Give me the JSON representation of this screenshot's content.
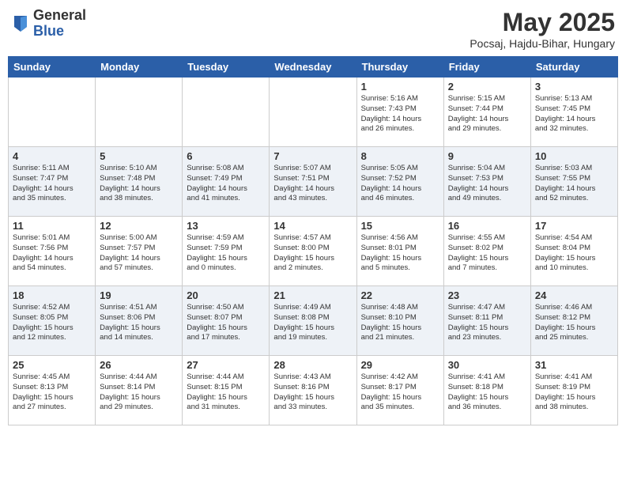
{
  "header": {
    "logo_general": "General",
    "logo_blue": "Blue",
    "title": "May 2025",
    "location": "Pocsaj, Hajdu-Bihar, Hungary"
  },
  "days_of_week": [
    "Sunday",
    "Monday",
    "Tuesday",
    "Wednesday",
    "Thursday",
    "Friday",
    "Saturday"
  ],
  "weeks": [
    [
      {
        "day": "",
        "info": ""
      },
      {
        "day": "",
        "info": ""
      },
      {
        "day": "",
        "info": ""
      },
      {
        "day": "",
        "info": ""
      },
      {
        "day": "1",
        "info": "Sunrise: 5:16 AM\nSunset: 7:43 PM\nDaylight: 14 hours\nand 26 minutes."
      },
      {
        "day": "2",
        "info": "Sunrise: 5:15 AM\nSunset: 7:44 PM\nDaylight: 14 hours\nand 29 minutes."
      },
      {
        "day": "3",
        "info": "Sunrise: 5:13 AM\nSunset: 7:45 PM\nDaylight: 14 hours\nand 32 minutes."
      }
    ],
    [
      {
        "day": "4",
        "info": "Sunrise: 5:11 AM\nSunset: 7:47 PM\nDaylight: 14 hours\nand 35 minutes."
      },
      {
        "day": "5",
        "info": "Sunrise: 5:10 AM\nSunset: 7:48 PM\nDaylight: 14 hours\nand 38 minutes."
      },
      {
        "day": "6",
        "info": "Sunrise: 5:08 AM\nSunset: 7:49 PM\nDaylight: 14 hours\nand 41 minutes."
      },
      {
        "day": "7",
        "info": "Sunrise: 5:07 AM\nSunset: 7:51 PM\nDaylight: 14 hours\nand 43 minutes."
      },
      {
        "day": "8",
        "info": "Sunrise: 5:05 AM\nSunset: 7:52 PM\nDaylight: 14 hours\nand 46 minutes."
      },
      {
        "day": "9",
        "info": "Sunrise: 5:04 AM\nSunset: 7:53 PM\nDaylight: 14 hours\nand 49 minutes."
      },
      {
        "day": "10",
        "info": "Sunrise: 5:03 AM\nSunset: 7:55 PM\nDaylight: 14 hours\nand 52 minutes."
      }
    ],
    [
      {
        "day": "11",
        "info": "Sunrise: 5:01 AM\nSunset: 7:56 PM\nDaylight: 14 hours\nand 54 minutes."
      },
      {
        "day": "12",
        "info": "Sunrise: 5:00 AM\nSunset: 7:57 PM\nDaylight: 14 hours\nand 57 minutes."
      },
      {
        "day": "13",
        "info": "Sunrise: 4:59 AM\nSunset: 7:59 PM\nDaylight: 15 hours\nand 0 minutes."
      },
      {
        "day": "14",
        "info": "Sunrise: 4:57 AM\nSunset: 8:00 PM\nDaylight: 15 hours\nand 2 minutes."
      },
      {
        "day": "15",
        "info": "Sunrise: 4:56 AM\nSunset: 8:01 PM\nDaylight: 15 hours\nand 5 minutes."
      },
      {
        "day": "16",
        "info": "Sunrise: 4:55 AM\nSunset: 8:02 PM\nDaylight: 15 hours\nand 7 minutes."
      },
      {
        "day": "17",
        "info": "Sunrise: 4:54 AM\nSunset: 8:04 PM\nDaylight: 15 hours\nand 10 minutes."
      }
    ],
    [
      {
        "day": "18",
        "info": "Sunrise: 4:52 AM\nSunset: 8:05 PM\nDaylight: 15 hours\nand 12 minutes."
      },
      {
        "day": "19",
        "info": "Sunrise: 4:51 AM\nSunset: 8:06 PM\nDaylight: 15 hours\nand 14 minutes."
      },
      {
        "day": "20",
        "info": "Sunrise: 4:50 AM\nSunset: 8:07 PM\nDaylight: 15 hours\nand 17 minutes."
      },
      {
        "day": "21",
        "info": "Sunrise: 4:49 AM\nSunset: 8:08 PM\nDaylight: 15 hours\nand 19 minutes."
      },
      {
        "day": "22",
        "info": "Sunrise: 4:48 AM\nSunset: 8:10 PM\nDaylight: 15 hours\nand 21 minutes."
      },
      {
        "day": "23",
        "info": "Sunrise: 4:47 AM\nSunset: 8:11 PM\nDaylight: 15 hours\nand 23 minutes."
      },
      {
        "day": "24",
        "info": "Sunrise: 4:46 AM\nSunset: 8:12 PM\nDaylight: 15 hours\nand 25 minutes."
      }
    ],
    [
      {
        "day": "25",
        "info": "Sunrise: 4:45 AM\nSunset: 8:13 PM\nDaylight: 15 hours\nand 27 minutes."
      },
      {
        "day": "26",
        "info": "Sunrise: 4:44 AM\nSunset: 8:14 PM\nDaylight: 15 hours\nand 29 minutes."
      },
      {
        "day": "27",
        "info": "Sunrise: 4:44 AM\nSunset: 8:15 PM\nDaylight: 15 hours\nand 31 minutes."
      },
      {
        "day": "28",
        "info": "Sunrise: 4:43 AM\nSunset: 8:16 PM\nDaylight: 15 hours\nand 33 minutes."
      },
      {
        "day": "29",
        "info": "Sunrise: 4:42 AM\nSunset: 8:17 PM\nDaylight: 15 hours\nand 35 minutes."
      },
      {
        "day": "30",
        "info": "Sunrise: 4:41 AM\nSunset: 8:18 PM\nDaylight: 15 hours\nand 36 minutes."
      },
      {
        "day": "31",
        "info": "Sunrise: 4:41 AM\nSunset: 8:19 PM\nDaylight: 15 hours\nand 38 minutes."
      }
    ]
  ]
}
